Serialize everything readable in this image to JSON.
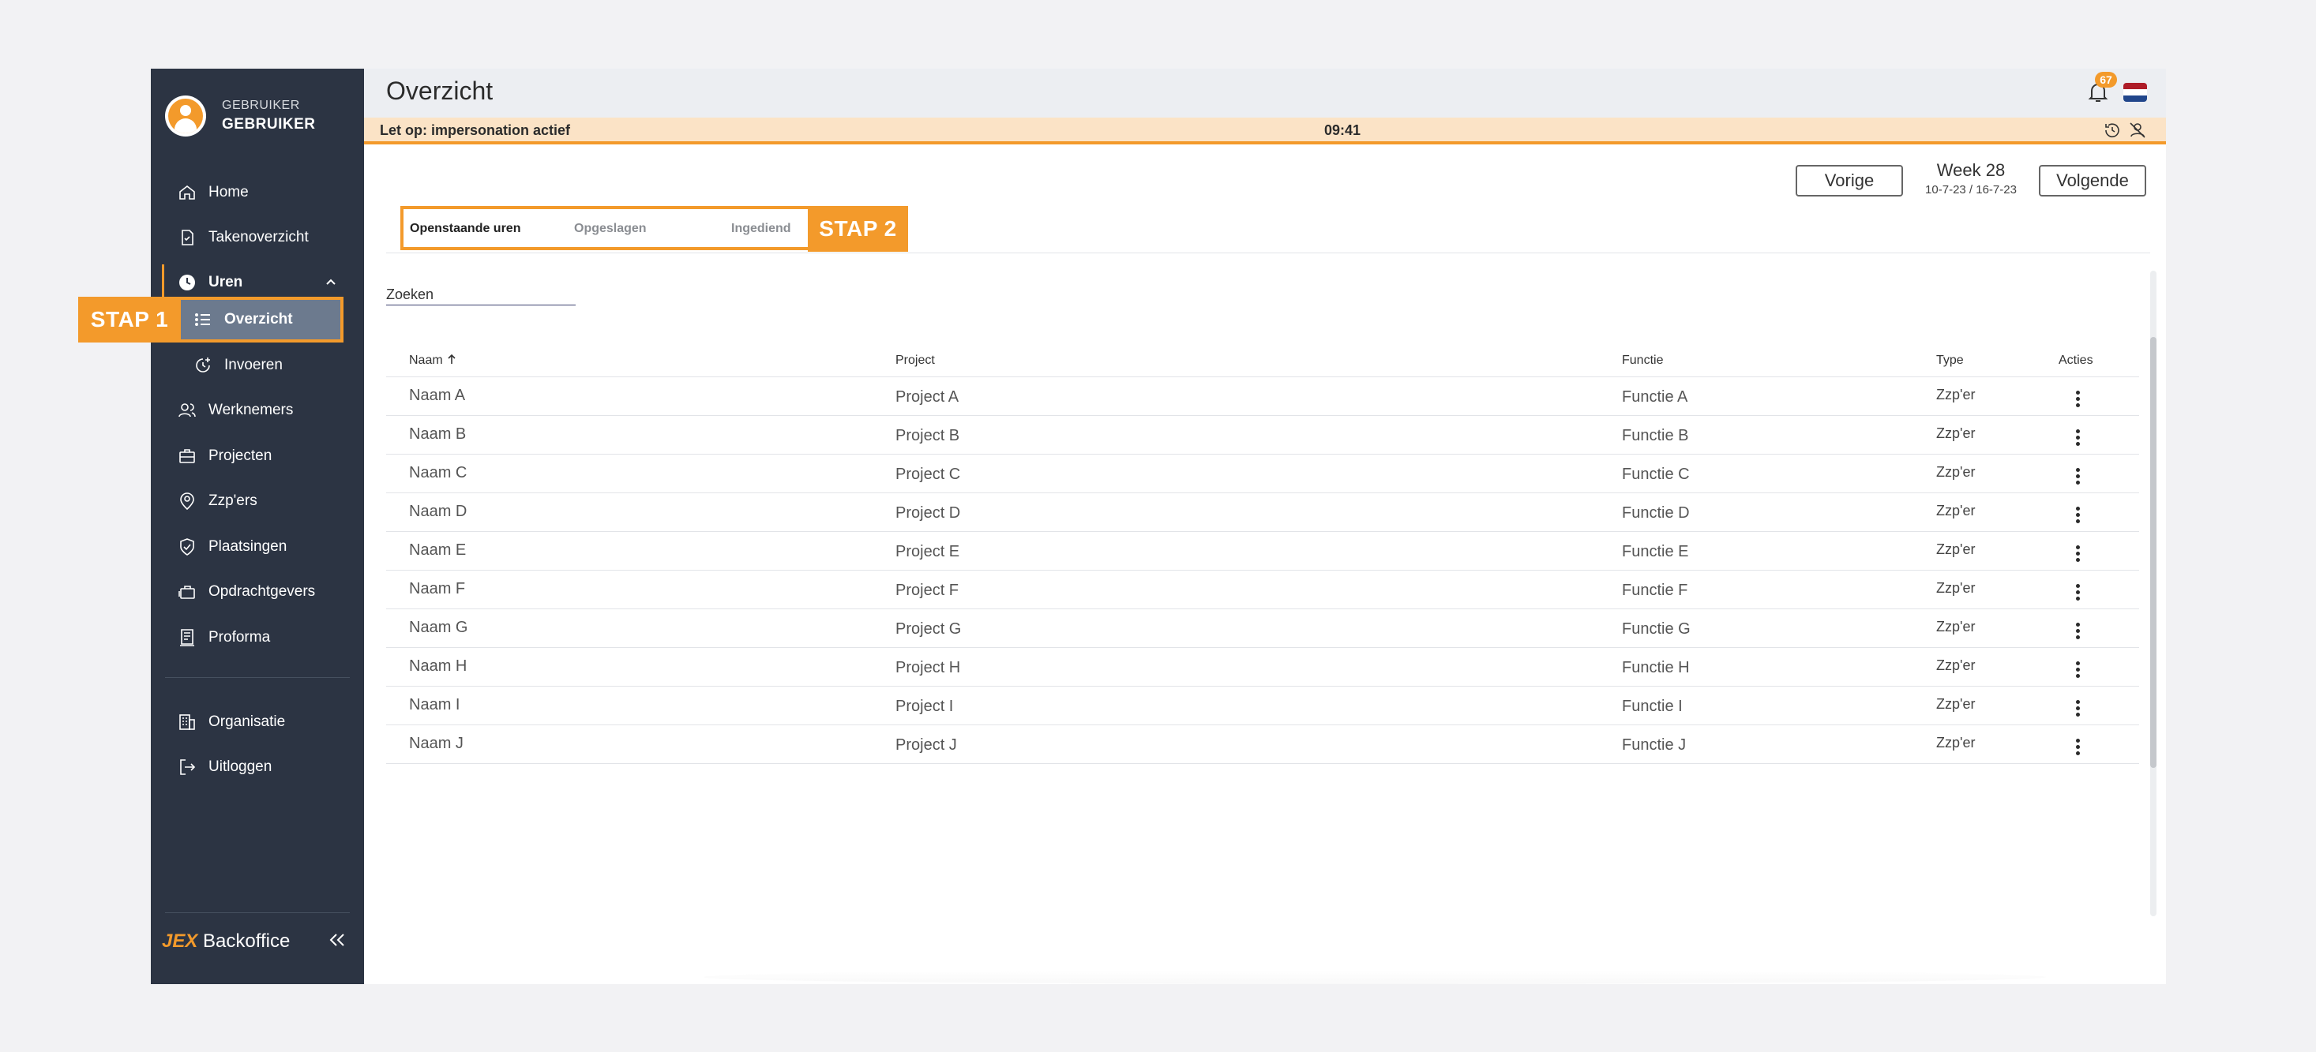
{
  "user": {
    "role": "GEBRUIKER",
    "name": "GEBRUIKER"
  },
  "sidebar": {
    "items": [
      {
        "label": "Home",
        "icon": "home-icon"
      },
      {
        "label": "Takenoverzicht",
        "icon": "task-icon"
      },
      {
        "label": "Uren",
        "icon": "clock-icon"
      },
      {
        "label": "Overzicht",
        "icon": "list-icon"
      },
      {
        "label": "Invoeren",
        "icon": "time-add-icon"
      },
      {
        "label": "Werknemers",
        "icon": "users-icon"
      },
      {
        "label": "Projecten",
        "icon": "briefcase-icon"
      },
      {
        "label": "Zzp'ers",
        "icon": "badge-icon"
      },
      {
        "label": "Plaatsingen",
        "icon": "shield-check-icon"
      },
      {
        "label": "Opdrachtgevers",
        "icon": "suitcase-icon"
      },
      {
        "label": "Proforma",
        "icon": "receipt-icon"
      },
      {
        "label": "Organisatie",
        "icon": "building-icon"
      },
      {
        "label": "Uitloggen",
        "icon": "logout-icon"
      }
    ],
    "logo_prefix": "JEX",
    "logo_text": "Backoffice"
  },
  "annotations": {
    "step1": "STAP 1",
    "step2": "STAP 2"
  },
  "header": {
    "title": "Overzicht",
    "notification_count": "67"
  },
  "banner": {
    "text": "Let op: impersonation actief",
    "time": "09:41"
  },
  "week": {
    "prev": "Vorige",
    "next": "Volgende",
    "title": "Week 28",
    "range": "10-7-23 / 16-7-23"
  },
  "tabs": [
    {
      "label": "Openstaande uren",
      "active": true
    },
    {
      "label": "Opgeslagen",
      "active": false
    },
    {
      "label": "Ingediend",
      "active": false
    }
  ],
  "search": {
    "placeholder": "Zoeken"
  },
  "table": {
    "headers": {
      "name": "Naam",
      "project": "Project",
      "function": "Functie",
      "type": "Type",
      "actions": "Acties"
    },
    "rows": [
      {
        "name": "Naam A",
        "project": "Project A",
        "function": "Functie A",
        "type": "Zzp'er"
      },
      {
        "name": "Naam B",
        "project": "Project B",
        "function": "Functie B",
        "type": "Zzp'er"
      },
      {
        "name": "Naam C",
        "project": "Project C",
        "function": "Functie C",
        "type": "Zzp'er"
      },
      {
        "name": "Naam D",
        "project": "Project D",
        "function": "Functie D",
        "type": "Zzp'er"
      },
      {
        "name": "Naam E",
        "project": "Project E",
        "function": "Functie E",
        "type": "Zzp'er"
      },
      {
        "name": "Naam F",
        "project": "Project F",
        "function": "Functie F",
        "type": "Zzp'er"
      },
      {
        "name": "Naam G",
        "project": "Project G",
        "function": "Functie G",
        "type": "Zzp'er"
      },
      {
        "name": "Naam H",
        "project": "Project H",
        "function": "Functie H",
        "type": "Zzp'er"
      },
      {
        "name": "Naam I",
        "project": "Project I",
        "function": "Functie I",
        "type": "Zzp'er"
      },
      {
        "name": "Naam J",
        "project": "Project J",
        "function": "Functie J",
        "type": "Zzp'er"
      }
    ]
  },
  "colors": {
    "accent": "#f39a2b",
    "sidebar": "#2c3443",
    "active": "#6c7a8e",
    "banner": "#fbe3c6"
  }
}
